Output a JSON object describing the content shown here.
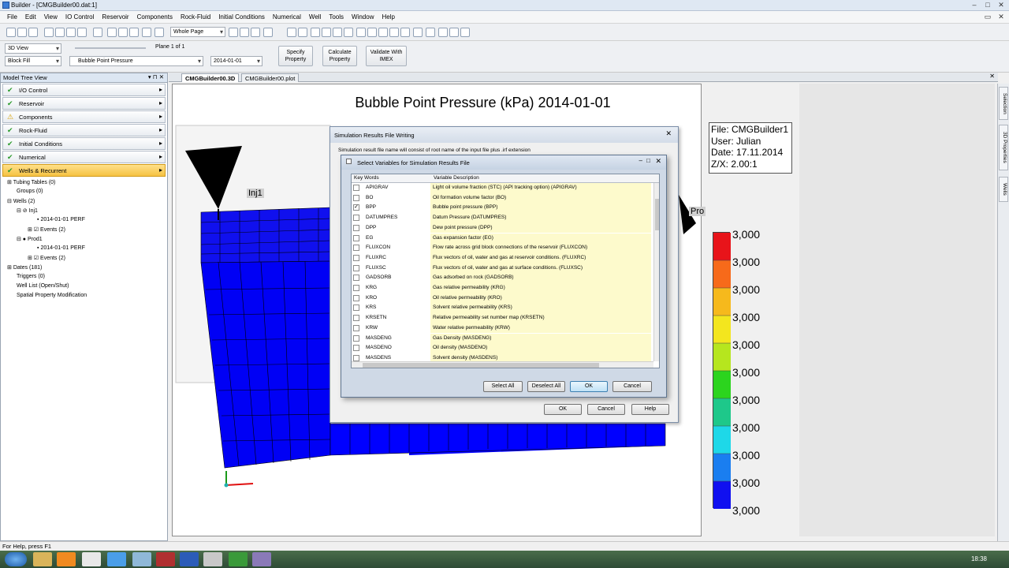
{
  "window": {
    "title": "Builder - [CMGBuilder00.dat:1]"
  },
  "menu": [
    "File",
    "Edit",
    "View",
    "IO Control",
    "Reservoir",
    "Components",
    "Rock-Fluid",
    "Initial Conditions",
    "Numerical",
    "Well",
    "Tools",
    "Window",
    "Help"
  ],
  "toolbar": {
    "zoom_combo": "Whole Page"
  },
  "controls": {
    "view_mode": "3D View",
    "fill_mode": "Block Fill",
    "property": "Bubble Point Pressure",
    "date": "2014-01-01",
    "plane": "Plane 1 of 1",
    "specify_property": "Specify Property",
    "calculate_property": "Calculate Property",
    "validate_imex": "Validate With IMEX"
  },
  "tree": {
    "title": "Model Tree View",
    "sections": [
      {
        "label": "I/O Control",
        "status": "check"
      },
      {
        "label": "Reservoir",
        "status": "check"
      },
      {
        "label": "Components",
        "status": "warn"
      },
      {
        "label": "Rock-Fluid",
        "status": "check"
      },
      {
        "label": "Initial Conditions",
        "status": "check"
      },
      {
        "label": "Numerical",
        "status": "check"
      },
      {
        "label": "Wells & Recurrent",
        "status": "check"
      }
    ],
    "nodes": {
      "tubing": "Tubing Tables (0)",
      "groups": "Groups (0)",
      "wells": "Wells (2)",
      "inj1": "Inj1",
      "inj1_perf": "2014-01-01  PERF",
      "inj1_events": "Events (2)",
      "prod1": "Prod1",
      "prod1_perf": "2014-01-01  PERF",
      "prod1_events": "Events (2)",
      "dates": "Dates (181)",
      "triggers": "Triggers (0)",
      "welllist": "Well List (Open/Shut)",
      "spatial": "Spatial Property Modification"
    }
  },
  "tabs": [
    "CMGBuilder00.3D",
    "CMGBuilder00.plot"
  ],
  "side_tabs": [
    "Selection",
    "3D Properties",
    "Wells"
  ],
  "view": {
    "title": "Bubble Point Pressure (kPa) 2014-01-01",
    "info": [
      "File: CMGBuilder1",
      "User:  Julian",
      "Date: 17.11.2014",
      "Z/X: 2.00:1"
    ],
    "legend": [
      "3,000",
      "3,000",
      "3,000",
      "3,000",
      "3,000",
      "3,000",
      "3,000",
      "3,000",
      "3,000",
      "3,000",
      "3,000"
    ],
    "well_inj": "Inj1",
    "well_prod": "Pro"
  },
  "dialog_outer": {
    "title": "Simulation Results File Writing",
    "note": "Simulation result file name will consist of root name of the input file plus .irf extension",
    "ok": "OK",
    "cancel": "Cancel",
    "help": "Help"
  },
  "dialog_inner": {
    "title": "Select Variables for Simulation Results File",
    "col_keywords": "Key Words",
    "col_desc": "Variable Description",
    "rows": [
      {
        "kw": "APIGRAV",
        "desc": "Light oil volume fraction (STC) (API tracking option) (APIGRAV)",
        "checked": false
      },
      {
        "kw": "BO",
        "desc": "Oil formation volume factor (BO)",
        "checked": false
      },
      {
        "kw": "BPP",
        "desc": "Bubble point pressure (BPP)",
        "checked": true
      },
      {
        "kw": "DATUMPRES",
        "desc": "Datum Pressure (DATUMPRES)",
        "checked": false
      },
      {
        "kw": "DPP",
        "desc": "Dew point pressure (DPP)",
        "checked": false
      },
      {
        "kw": "EG",
        "desc": "Gas expansion factor (EG)",
        "checked": false
      },
      {
        "kw": "FLUXCON",
        "desc": "Flow rate across grid block connections of the reservoir (FLUXCON)",
        "checked": false
      },
      {
        "kw": "FLUXRC",
        "desc": "Flux vectors of oil, water and gas at reservoir conditions. (FLUXRC)",
        "checked": false
      },
      {
        "kw": "FLUXSC",
        "desc": "Flux vectors of oil, water and gas at surface conditions. (FLUXSC)",
        "checked": false
      },
      {
        "kw": "GADSORB",
        "desc": "Gas adsorbed on rock (GADSORB)",
        "checked": false
      },
      {
        "kw": "KRG",
        "desc": "Gas relative permeability (KRG)",
        "checked": false
      },
      {
        "kw": "KRO",
        "desc": "Oil relative permeability (KRO)",
        "checked": false
      },
      {
        "kw": "KRS",
        "desc": "Solvent relative permeability (KRS)",
        "checked": false
      },
      {
        "kw": "KRSETN",
        "desc": "Relative permeability set number map (KRSETN)",
        "checked": false
      },
      {
        "kw": "KRW",
        "desc": "Water relative permeability (KRW)",
        "checked": false
      },
      {
        "kw": "MASDENG",
        "desc": "Gas Density (MASDENG)",
        "checked": false
      },
      {
        "kw": "MASDENO",
        "desc": "Oil density (MASDENO)",
        "checked": false
      },
      {
        "kw": "MASDENS",
        "desc": "Solvent density (MASDENS)",
        "checked": false
      }
    ],
    "select_all": "Select All",
    "deselect_all": "Deselect All",
    "ok": "OK",
    "cancel": "Cancel"
  },
  "status": "For Help, press F1",
  "clock": "18:38",
  "colors": {
    "grid_blue": "#0000ff",
    "accent": "#f5c242"
  }
}
